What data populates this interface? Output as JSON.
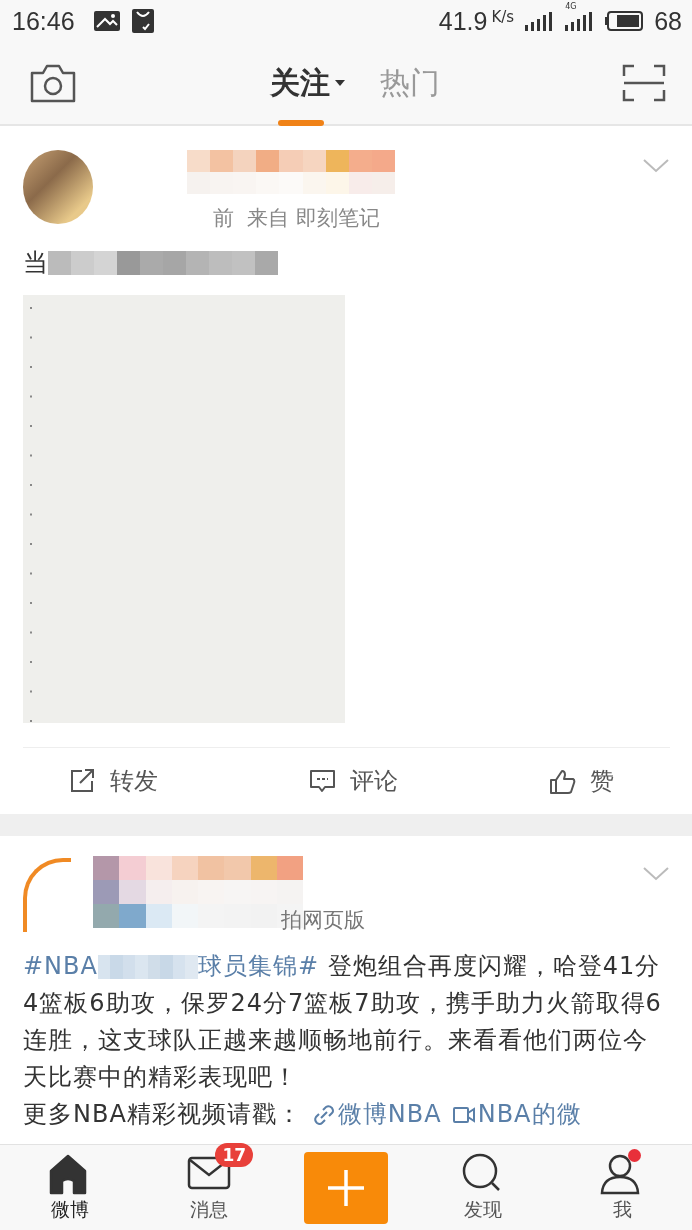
{
  "status_bar": {
    "time": "16:46",
    "speed": "41.9",
    "speed_unit": "K/s",
    "network": "4G",
    "battery": "68"
  },
  "header": {
    "tabs": [
      {
        "label": "关注",
        "selected": true,
        "dropdown": true
      },
      {
        "label": "热门",
        "selected": false,
        "dropdown": false
      }
    ]
  },
  "posts": [
    {
      "source": "前  来自 即刻笔记",
      "text": "当",
      "actions": [
        {
          "kind": "repost",
          "label": "转发"
        },
        {
          "kind": "comment",
          "label": "评论"
        },
        {
          "kind": "like",
          "label": "赞"
        }
      ]
    },
    {
      "source": "拍网页版",
      "hashtag_start": "#NBA",
      "hashtag_end": "球员集锦#",
      "text": "登炮组合再度闪耀，哈登41分4篮板6助攻，保罗24分7篮板7助攻，携手助力火箭取得6连胜，这支球队正越来越顺畅地前行。来看看他们两位今天比赛中的精彩表现吧！",
      "more_text": "更多NBA精彩视频请戳：",
      "links": [
        {
          "kind": "link",
          "label": "微博NBA"
        },
        {
          "kind": "video",
          "label": "NBA的微"
        }
      ]
    }
  ],
  "nav": [
    {
      "kind": "home",
      "label": "微博",
      "selected": true
    },
    {
      "kind": "mail",
      "label": "消息",
      "selected": false,
      "badge": "17"
    },
    {
      "kind": "compose",
      "selected": false
    },
    {
      "kind": "search",
      "label": "发现",
      "selected": false
    },
    {
      "kind": "profile",
      "label": "我",
      "selected": false,
      "dot": true
    }
  ]
}
